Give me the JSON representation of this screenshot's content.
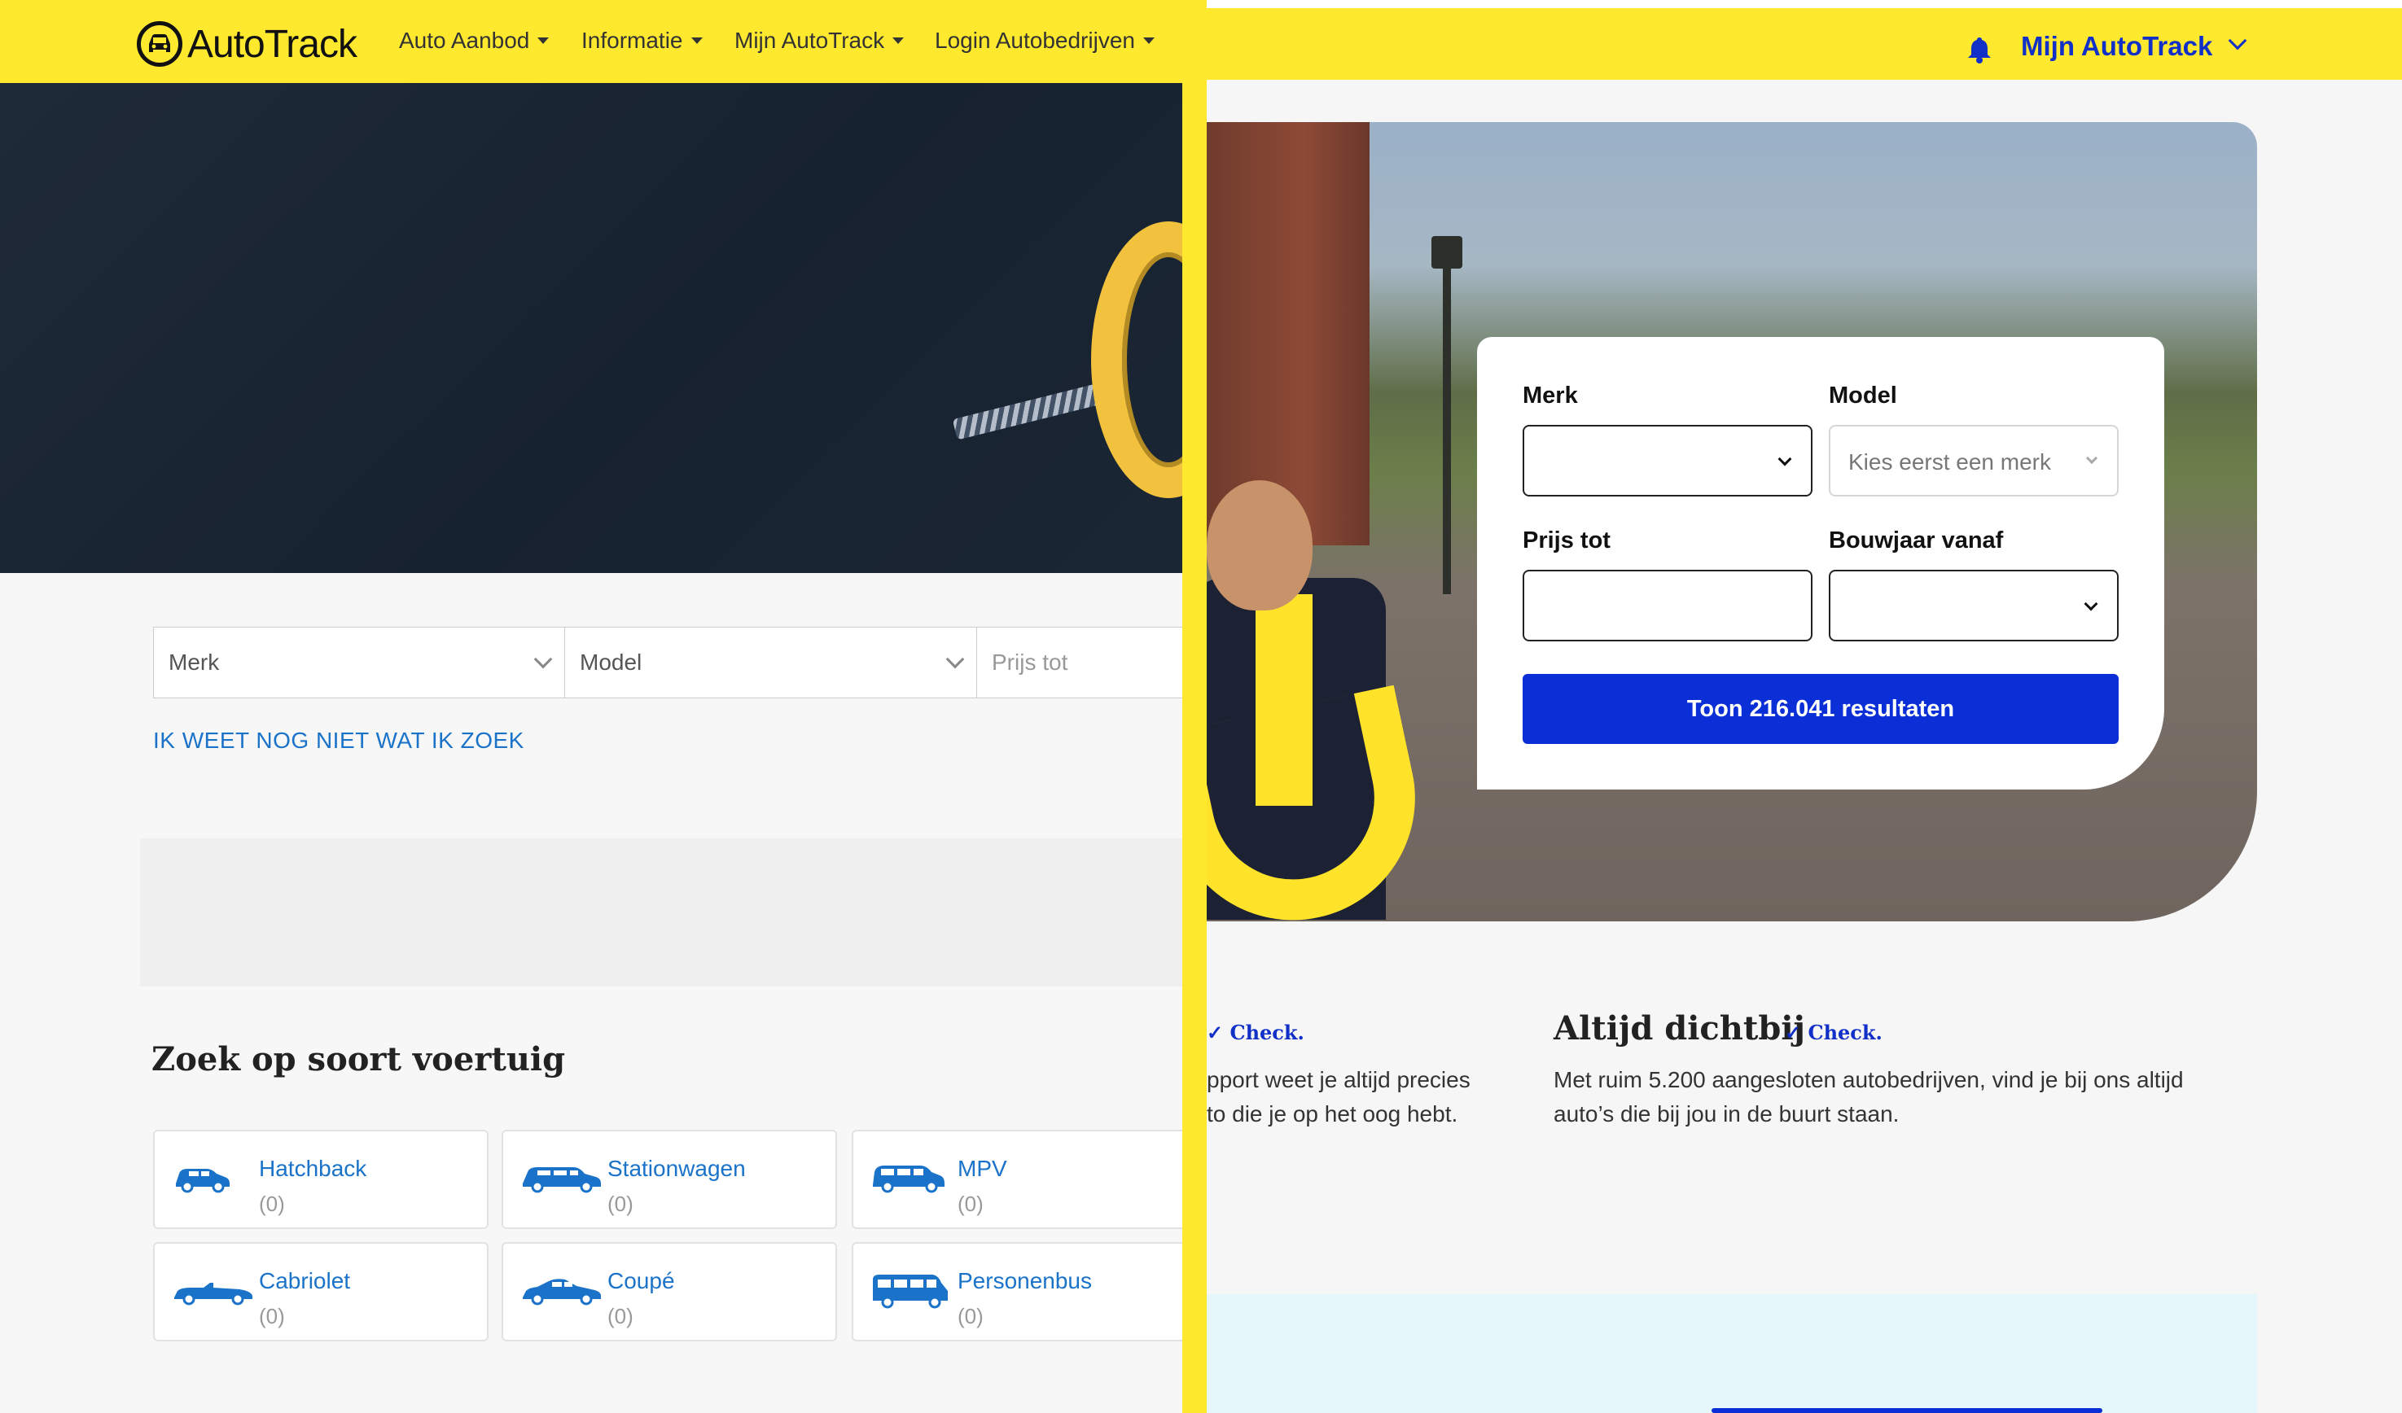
{
  "left": {
    "logo": "AutoTrack",
    "nav": [
      {
        "label": "Auto Aanbod"
      },
      {
        "label": "Informatie"
      },
      {
        "label": "Mijn AutoTrack"
      },
      {
        "label": "Login Autobedrijven"
      }
    ],
    "search": {
      "merk": "Merk",
      "model": "Model",
      "prijs_placeholder": "Prijs tot"
    },
    "ik_link": "IK WEET NOG NIET WAT IK ZOEK",
    "soort_title": "Zoek op soort voertuig",
    "tiles": [
      {
        "label": "Hatchback",
        "count": "(0)",
        "icon": "hatchback-icon"
      },
      {
        "label": "Stationwagen",
        "count": "(0)",
        "icon": "stationwagen-icon"
      },
      {
        "label": "MPV",
        "count": "(0)",
        "icon": "mpv-icon"
      },
      {
        "label": "Cabriolet",
        "count": "(0)",
        "icon": "cabriolet-icon"
      },
      {
        "label": "Coupé",
        "count": "(0)",
        "icon": "coupe-icon"
      },
      {
        "label": "Personenbus",
        "count": "(0)",
        "icon": "personenbus-icon"
      }
    ]
  },
  "right": {
    "nav_label": "Mijn AutoTrack",
    "form": {
      "merk_label": "Merk",
      "model_label": "Model",
      "model_placeholder": "Kies eerst een merk",
      "prijs_label": "Prijs tot",
      "bouwjaar_label": "Bouwjaar vanaf",
      "button": "Toon 216.041 resultaten"
    },
    "feature_left": {
      "check": "Check.",
      "line1": "pport weet je altijd precies",
      "line2": "to die je op het oog hebt."
    },
    "feature_right": {
      "title": "Altijd dichtbij",
      "check": "Check.",
      "text": "Met ruim 5.200 aangesloten autobedrijven, vind je bij ons altijd auto’s die bij jou in de buurt staan."
    }
  },
  "colors": {
    "brand_yellow": "#ffe92e",
    "link_blue": "#1a73c9",
    "button_blue": "#0a2fd6",
    "nav_blue": "#1030c8"
  }
}
